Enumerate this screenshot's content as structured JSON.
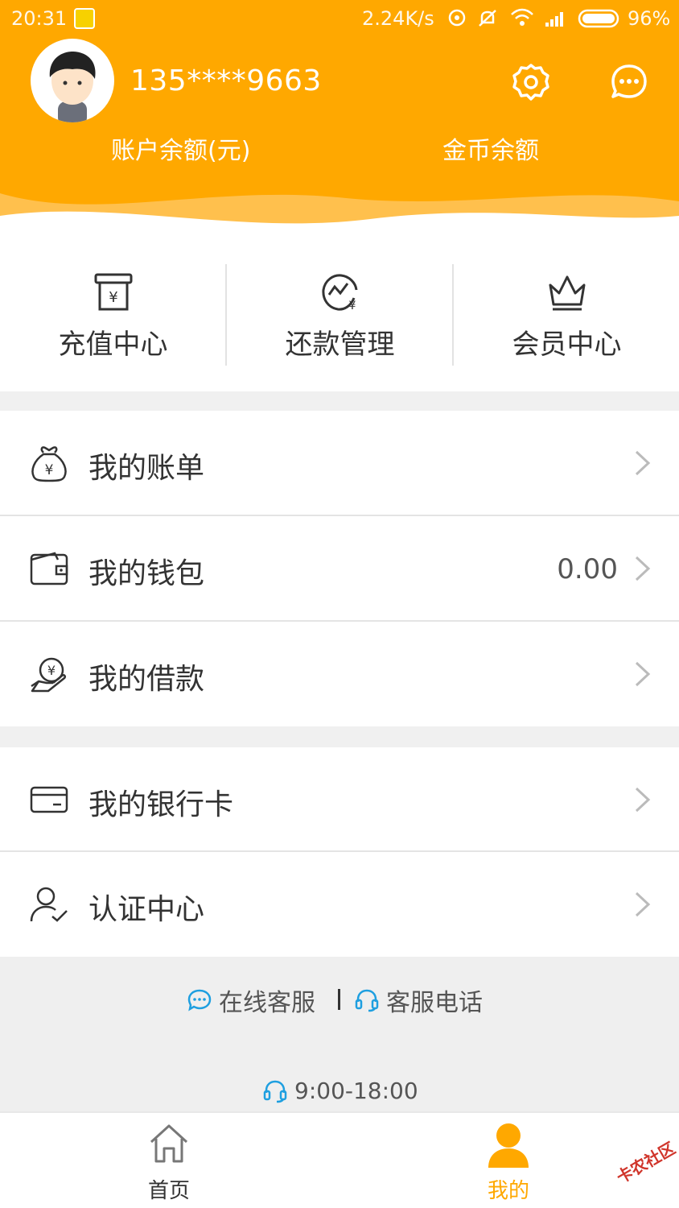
{
  "status_bar": {
    "time": "20:31",
    "net_speed": "2.24K/s",
    "battery": "96%"
  },
  "profile": {
    "phone": "135****9663",
    "account_balance_label": "账户余额(元)",
    "coin_balance_label": "金币余额"
  },
  "quick_actions": [
    {
      "label": "充值中心",
      "icon": "recharge-icon"
    },
    {
      "label": "还款管理",
      "icon": "repayment-icon"
    },
    {
      "label": "会员中心",
      "icon": "crown-icon"
    }
  ],
  "menu": {
    "bill": {
      "label": "我的账单",
      "icon": "money-bag-icon"
    },
    "wallet": {
      "label": "我的钱包",
      "value": "0.00",
      "icon": "wallet-icon"
    },
    "loan": {
      "label": "我的借款",
      "icon": "loan-hand-icon"
    },
    "bank_card": {
      "label": "我的银行卡",
      "icon": "bank-card-icon"
    },
    "verification": {
      "label": "认证中心",
      "icon": "user-check-icon"
    }
  },
  "support": {
    "online_service": "在线客服",
    "service_phone": "客服电话",
    "hours": "9:00-18:00"
  },
  "bottom_nav": [
    {
      "label": "首页",
      "icon": "home-icon",
      "active": false
    },
    {
      "label": "我的",
      "icon": "person-icon",
      "active": true
    }
  ],
  "watermark": "卡农社区",
  "colors": {
    "brand": "#ffa800",
    "accent_blue": "#1e9fe0",
    "text": "#333333"
  }
}
